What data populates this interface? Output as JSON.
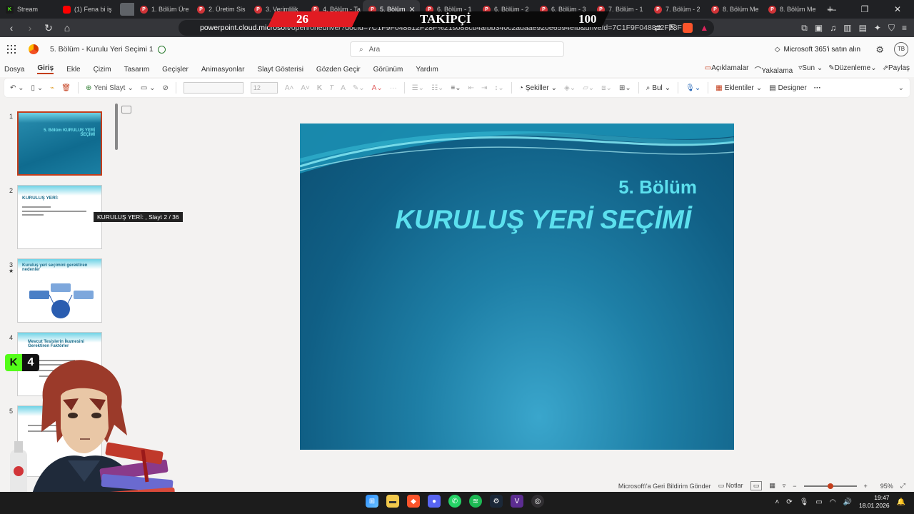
{
  "browser": {
    "tabs": [
      {
        "label": "Stream",
        "icon": "kick-icon"
      },
      {
        "label": "(1) Fena bi iş",
        "icon": "youtube-icon"
      },
      {
        "label": "",
        "icon": "blank-tab-icon"
      },
      {
        "label": "1. Bölüm Üre",
        "icon": "powerpoint-icon"
      },
      {
        "label": "2. Üretim Sis",
        "icon": "powerpoint-icon"
      },
      {
        "label": "3. Verimlilik",
        "icon": "powerpoint-icon"
      },
      {
        "label": "4. Bölüm - Ta",
        "icon": "powerpoint-icon"
      },
      {
        "label": "5. Bölüm",
        "icon": "powerpoint-icon",
        "active": true
      },
      {
        "label": "6. Bölüm - 1",
        "icon": "powerpoint-icon"
      },
      {
        "label": "6. Bölüm - 2",
        "icon": "powerpoint-icon"
      },
      {
        "label": "6. Bölüm - 3",
        "icon": "powerpoint-icon"
      },
      {
        "label": "7. Bölüm - 1",
        "icon": "powerpoint-icon"
      },
      {
        "label": "7. Bölüm - 2",
        "icon": "powerpoint-icon"
      },
      {
        "label": "8. Bölüm Me",
        "icon": "powerpoint-icon"
      },
      {
        "label": "8. Bölüm Me",
        "icon": "powerpoint-icon"
      }
    ],
    "url_host": "powerpoint.cloud.microsoft",
    "url_path": "/open/onedrive/?docId=7C1F9F048812F28F%21s088cb4afbb340c2adaae920e6594efb&driveId=7C1F9F048812F28F",
    "new_tab": "+",
    "window_controls": [
      "—",
      "❐",
      "✕"
    ]
  },
  "overlay": {
    "count": "26",
    "label": "TAKİPÇİ",
    "goal": "100",
    "kick_badge": "K",
    "kick_count": "4"
  },
  "office": {
    "doc_title": "5. Bölüm - Kurulu Yeri Seçimi 1",
    "search_placeholder": "Ara",
    "buy_label": "Microsoft 365'i satın alın",
    "avatar_initials": "TB"
  },
  "ribbon_tabs": [
    "Dosya",
    "Giriş",
    "Ekle",
    "Çizim",
    "Tasarım",
    "Geçişler",
    "Animasyonlar",
    "Slayt Gösterisi",
    "Gözden Geçir",
    "Görünüm",
    "Yardım"
  ],
  "ribbon_right": [
    "Açıklamalar",
    "Yakalama",
    "Sun",
    "Düzenleme",
    "Paylaş"
  ],
  "toolbar": {
    "new_slide": "Yeni Slayt",
    "font_size": "12",
    "shapes": "Şekiller",
    "find": "Bul",
    "addins": "Eklentiler",
    "designer": "Designer"
  },
  "thumbnails": [
    {
      "num": "1",
      "title": "5. Bölüm KURULUŞ YERİ SEÇİMİ"
    },
    {
      "num": "2",
      "title": "KURULUŞ YERİ:"
    },
    {
      "num": "3",
      "title": "Kuruluş yeri seçimini gerektiren nedenler"
    },
    {
      "num": "4",
      "title": "Mevcut Tesislerin İkamesini Gerektiren Faktörler"
    },
    {
      "num": "5",
      "title": ""
    }
  ],
  "tooltip": "KURULUŞ YERİ: , Slayt 2 / 36",
  "slide": {
    "subtitle": "5. Bölüm",
    "title": "KURULUŞ YERİ SEÇİMİ"
  },
  "statusbar": {
    "feedback": "Microsoft\\'a Geri Bildirim Gönder",
    "notes": "Notlar",
    "zoom": "95%",
    "zoom_level": 0.45
  },
  "taskbar": {
    "time": "19:47",
    "date": "18.01.2026"
  },
  "colors": {
    "accent": "#c43e1c",
    "slide_title": "#5ce0ee",
    "kick_green": "#53fc18",
    "banner_red": "#e11b22"
  }
}
